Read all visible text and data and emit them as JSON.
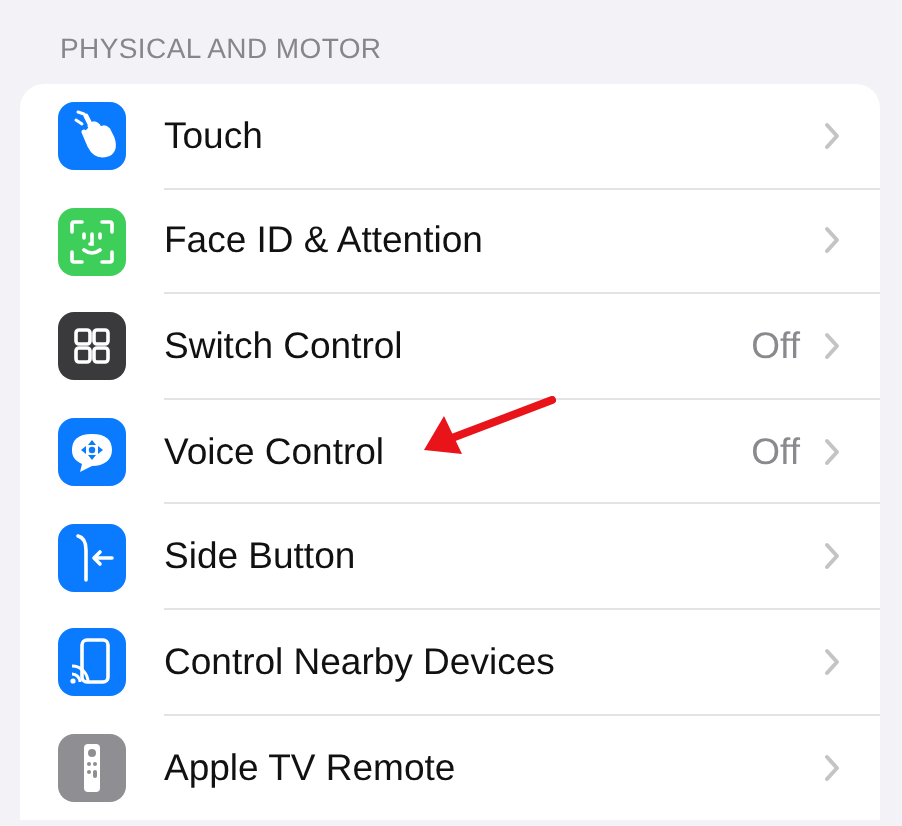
{
  "section": {
    "header": "PHYSICAL AND MOTOR"
  },
  "rows": [
    {
      "kind": "hand",
      "label": "Touch"
    },
    {
      "kind": "face",
      "label": "Face ID & Attention"
    },
    {
      "kind": "grid",
      "label": "Switch Control",
      "value": "Off"
    },
    {
      "kind": "voice",
      "label": "Voice Control",
      "value": "Off"
    },
    {
      "kind": "side",
      "label": "Side Button"
    },
    {
      "kind": "phone",
      "label": "Control Nearby Devices"
    },
    {
      "kind": "remote",
      "label": "Apple TV Remote"
    }
  ]
}
